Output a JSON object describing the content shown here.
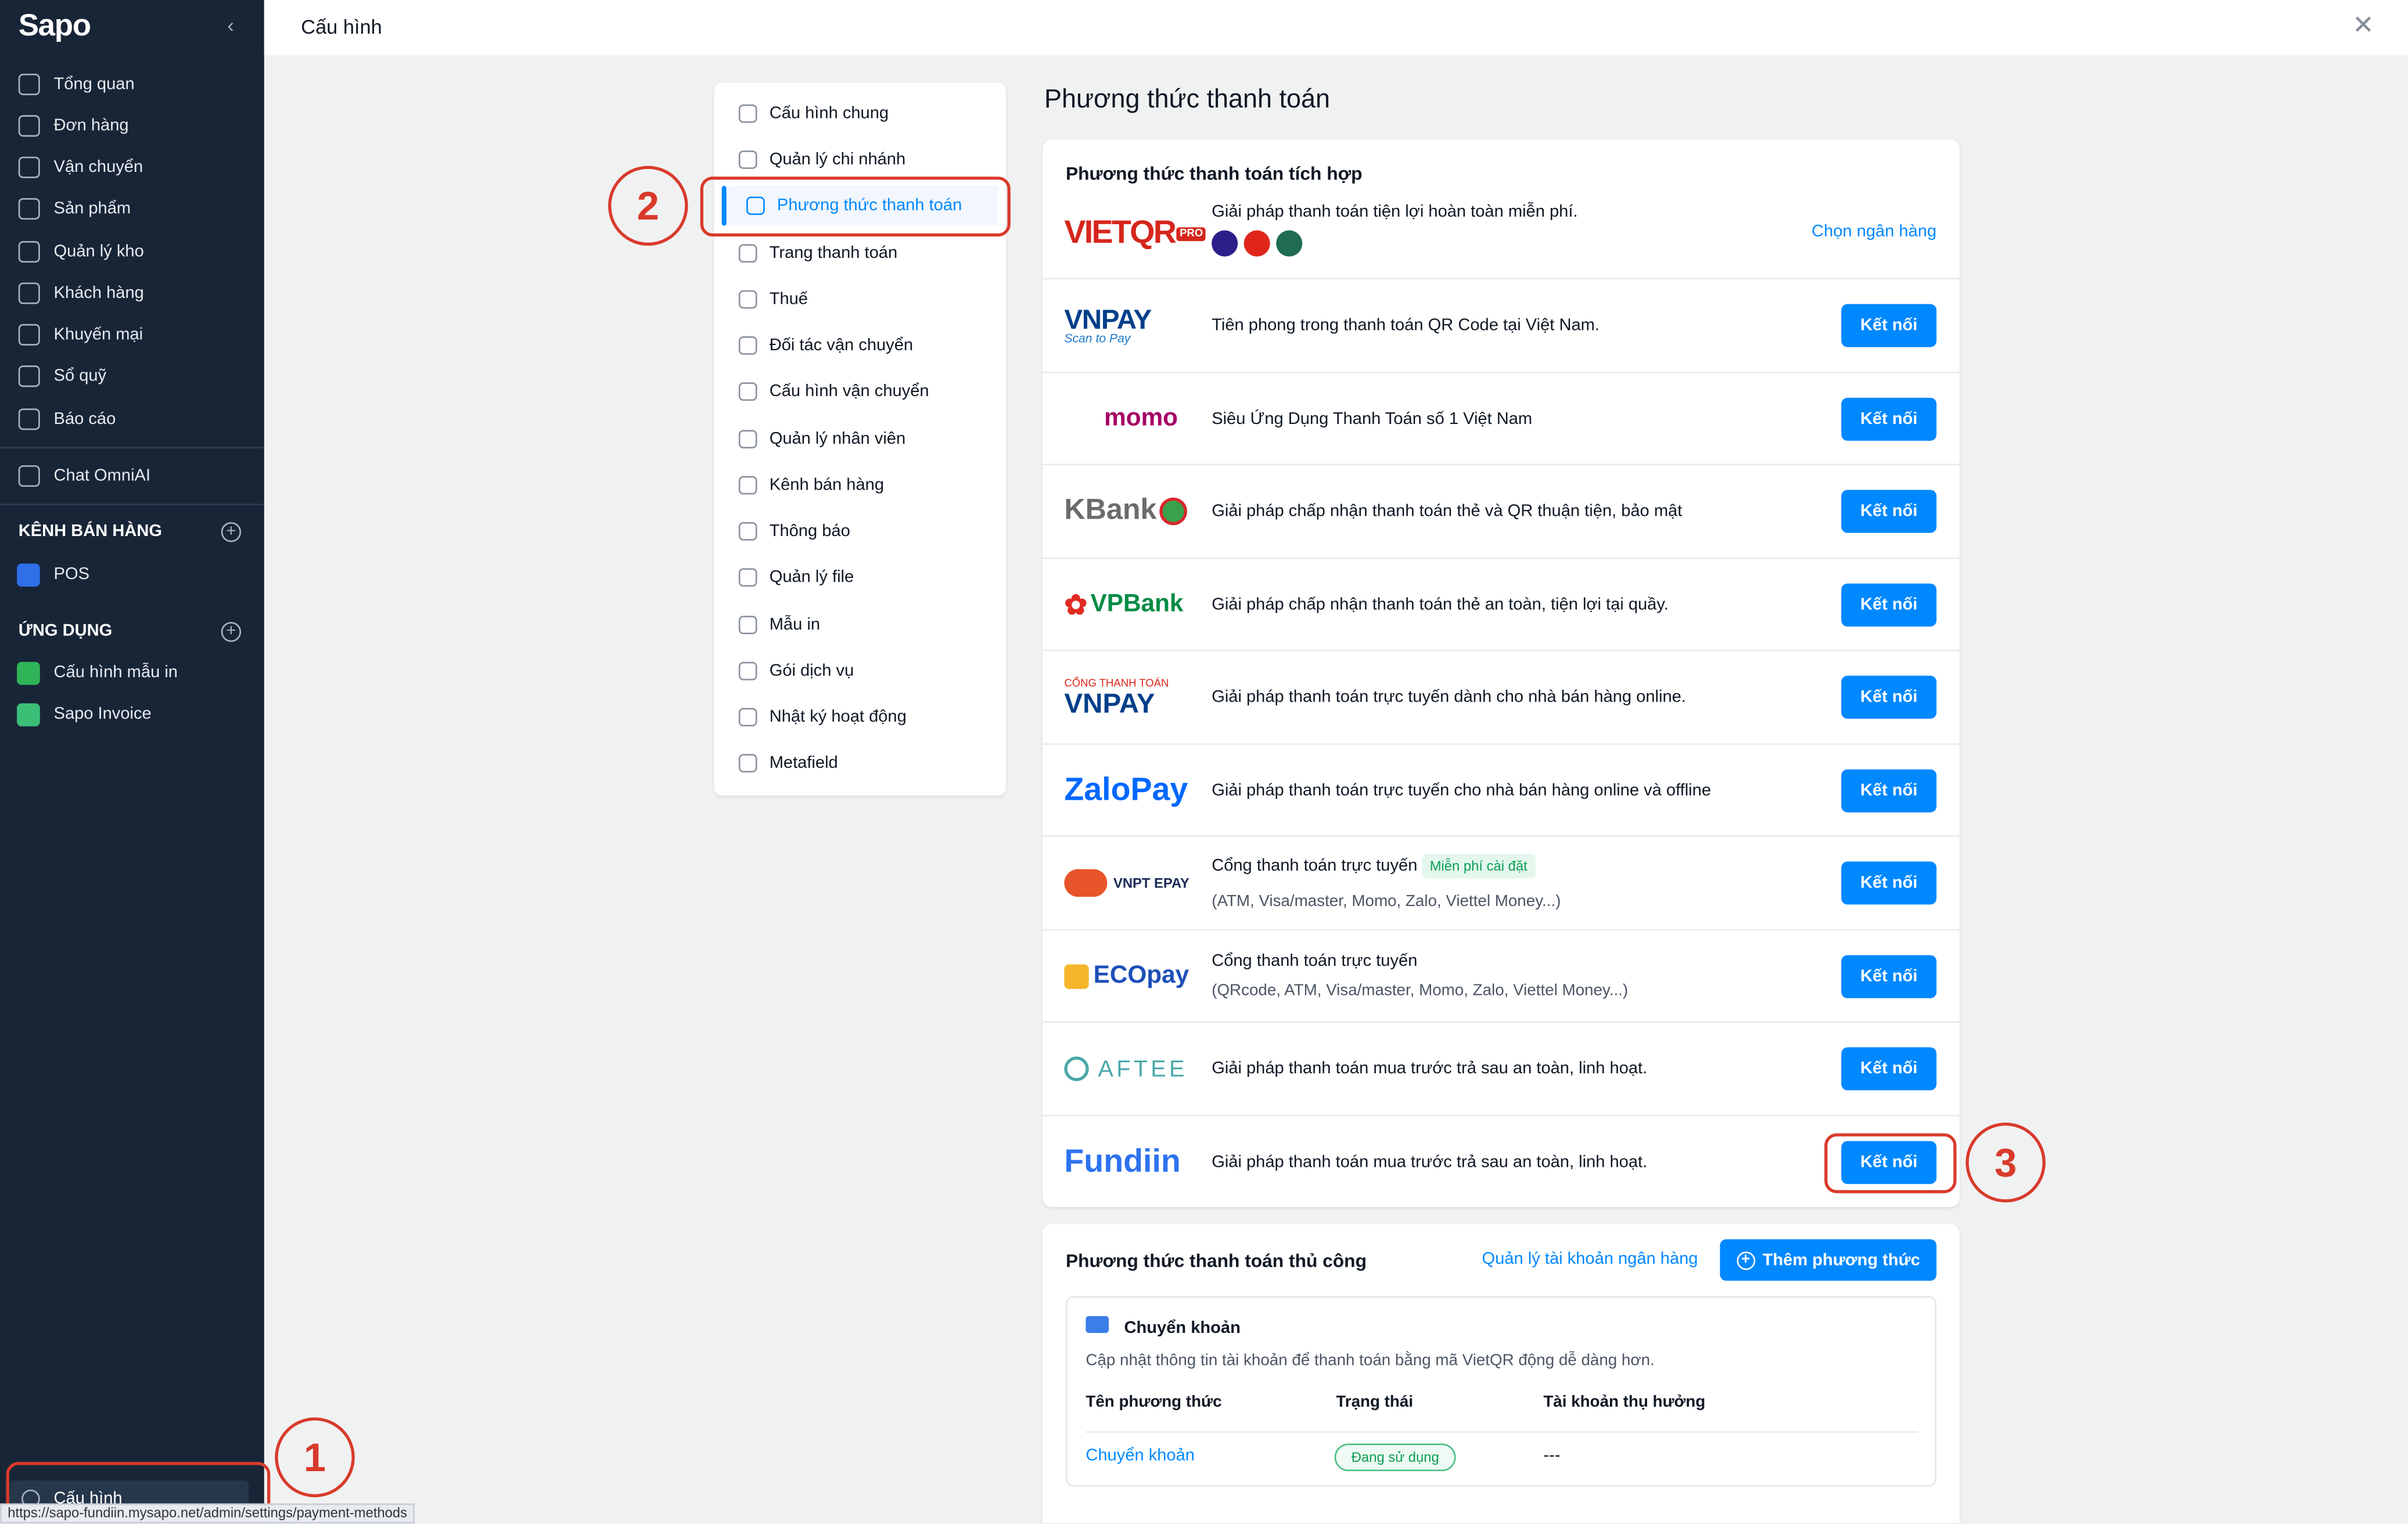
{
  "sidebar": {
    "logo": "Sapo",
    "nav": [
      {
        "label": "Tổng quan",
        "icon": "home-icon"
      },
      {
        "label": "Đơn hàng",
        "icon": "orders-icon"
      },
      {
        "label": "Vận chuyển",
        "icon": "truck-icon"
      },
      {
        "label": "Sản phẩm",
        "icon": "box-icon"
      },
      {
        "label": "Quản lý kho",
        "icon": "warehouse-icon"
      },
      {
        "label": "Khách hàng",
        "icon": "user-icon"
      },
      {
        "label": "Khuyến mại",
        "icon": "discount-icon"
      },
      {
        "label": "Sổ quỹ",
        "icon": "ledger-icon"
      },
      {
        "label": "Báo cáo",
        "icon": "chart-icon"
      }
    ],
    "chat": "Chat OmniAI",
    "channels_title": "KÊNH BÁN HÀNG",
    "channels": [
      {
        "label": "POS"
      }
    ],
    "apps_title": "ỨNG DỤNG",
    "apps": [
      {
        "label": "Cấu hình mẫu in"
      },
      {
        "label": "Sapo Invoice"
      }
    ],
    "bottom": "Cấu hình"
  },
  "topbar": {
    "title": "Cấu hình"
  },
  "menu": [
    {
      "label": "Cấu hình chung"
    },
    {
      "label": "Quản lý chi nhánh"
    },
    {
      "label": "Phương thức thanh toán",
      "active": true
    },
    {
      "label": "Trang thanh toán"
    },
    {
      "label": "Thuế"
    },
    {
      "label": "Đối tác vận chuyển"
    },
    {
      "label": "Cấu hình vận chuyển"
    },
    {
      "label": "Quản lý nhân viên"
    },
    {
      "label": "Kênh bán hàng"
    },
    {
      "label": "Thông báo"
    },
    {
      "label": "Quản lý file"
    },
    {
      "label": "Mẫu in"
    },
    {
      "label": "Gói dịch vụ"
    },
    {
      "label": "Nhật ký hoạt động"
    },
    {
      "label": "Metafield"
    }
  ],
  "main": {
    "page_title": "Phương thức thanh toán",
    "integrated": {
      "title": "Phương thức thanh toán tích hợp",
      "vietqr": {
        "logo": "VIETQR",
        "logo_suffix": "PRO",
        "desc": "Giải pháp thanh toán tiện lợi hoàn toàn miễn phí.",
        "action": "Chọn ngân hàng",
        "bank_dot_colors": [
          "#2d1f8a",
          "#e0261b",
          "#1f6b53"
        ]
      },
      "providers": [
        {
          "logo": "VNPAY",
          "logo_sub": "Scan to Pay",
          "desc": "Tiên phong trong thanh toán QR Code tại Việt Nam.",
          "button": "Kết nối"
        },
        {
          "logo": "momo",
          "desc": "Siêu Ứng Dụng Thanh Toán số 1 Việt Nam",
          "button": "Kết nối"
        },
        {
          "logo": "KBank",
          "desc": "Giải pháp chấp nhận thanh toán thẻ và QR thuận tiện, bảo mật",
          "button": "Kết nối"
        },
        {
          "logo": "VPBank",
          "desc": "Giải pháp chấp nhận thanh toán thẻ an toàn, tiện lợi tại quầy.",
          "button": "Kết nối"
        },
        {
          "logo": "VNPAY",
          "logo_top": "CỔNG THANH TOÁN",
          "desc": "Giải pháp thanh toán trực tuyến dành cho nhà bán hàng online.",
          "button": "Kết nối"
        },
        {
          "logo": "ZaloPay",
          "desc": "Giải pháp thanh toán trực tuyến cho nhà bán hàng online và offline",
          "button": "Kết nối"
        },
        {
          "logo": "VNPT EPAY",
          "desc": "Cổng thanh toán trực tuyến",
          "badge": "Miễn phí cài đặt",
          "sub": "(ATM, Visa/master, Momo, Zalo, Viettel Money...)",
          "button": "Kết nối"
        },
        {
          "logo": "ECOpay",
          "desc": "Cổng thanh toán trực tuyến",
          "sub": "(QRcode, ATM, Visa/master, Momo, Zalo, Viettel Money...)",
          "button": "Kết nối"
        },
        {
          "logo": "AFTEE",
          "desc": "Giải pháp thanh toán mua trước trả sau an toàn, linh hoạt.",
          "button": "Kết nối"
        },
        {
          "logo": "Fundiin",
          "desc": "Giải pháp thanh toán mua trước trả sau an toàn, linh hoạt.",
          "button": "Kết nối"
        }
      ]
    },
    "manual": {
      "title": "Phương thức thanh toán thủ công",
      "manage_link": "Quản lý tài khoản ngân hàng",
      "add_button": "Thêm phương thức",
      "transfer": {
        "title": "Chuyển khoản",
        "desc": "Cập nhật thông tin tài khoản để thanh toán bằng mã VietQR động dễ dàng hơn.",
        "columns": [
          "Tên phương thức",
          "Trạng thái",
          "Tài khoản thụ hưởng"
        ],
        "row": {
          "name": "Chuyển khoản",
          "status": "Đang sử dụng",
          "account": "---"
        }
      }
    }
  },
  "annotations": [
    "1",
    "2",
    "3"
  ],
  "status_url": "https://sapo-fundiin.mysapo.net/admin/settings/payment-methods",
  "colors": {
    "accent": "#0088ff",
    "sidebar": "#182537",
    "annotation": "#d93a2b"
  }
}
